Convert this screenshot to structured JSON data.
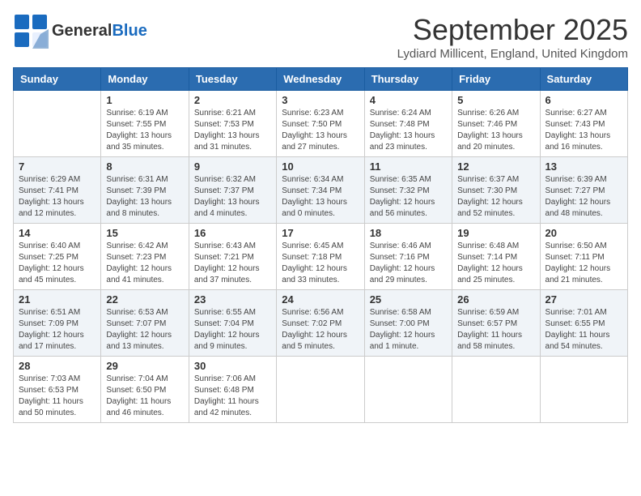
{
  "logo": {
    "line1": "General",
    "line2": "Blue"
  },
  "title": "September 2025",
  "location": "Lydiard Millicent, England, United Kingdom",
  "headers": [
    "Sunday",
    "Monday",
    "Tuesday",
    "Wednesday",
    "Thursday",
    "Friday",
    "Saturday"
  ],
  "weeks": [
    [
      {
        "day": "",
        "info": ""
      },
      {
        "day": "1",
        "info": "Sunrise: 6:19 AM\nSunset: 7:55 PM\nDaylight: 13 hours\nand 35 minutes."
      },
      {
        "day": "2",
        "info": "Sunrise: 6:21 AM\nSunset: 7:53 PM\nDaylight: 13 hours\nand 31 minutes."
      },
      {
        "day": "3",
        "info": "Sunrise: 6:23 AM\nSunset: 7:50 PM\nDaylight: 13 hours\nand 27 minutes."
      },
      {
        "day": "4",
        "info": "Sunrise: 6:24 AM\nSunset: 7:48 PM\nDaylight: 13 hours\nand 23 minutes."
      },
      {
        "day": "5",
        "info": "Sunrise: 6:26 AM\nSunset: 7:46 PM\nDaylight: 13 hours\nand 20 minutes."
      },
      {
        "day": "6",
        "info": "Sunrise: 6:27 AM\nSunset: 7:43 PM\nDaylight: 13 hours\nand 16 minutes."
      }
    ],
    [
      {
        "day": "7",
        "info": "Sunrise: 6:29 AM\nSunset: 7:41 PM\nDaylight: 13 hours\nand 12 minutes."
      },
      {
        "day": "8",
        "info": "Sunrise: 6:31 AM\nSunset: 7:39 PM\nDaylight: 13 hours\nand 8 minutes."
      },
      {
        "day": "9",
        "info": "Sunrise: 6:32 AM\nSunset: 7:37 PM\nDaylight: 13 hours\nand 4 minutes."
      },
      {
        "day": "10",
        "info": "Sunrise: 6:34 AM\nSunset: 7:34 PM\nDaylight: 13 hours\nand 0 minutes."
      },
      {
        "day": "11",
        "info": "Sunrise: 6:35 AM\nSunset: 7:32 PM\nDaylight: 12 hours\nand 56 minutes."
      },
      {
        "day": "12",
        "info": "Sunrise: 6:37 AM\nSunset: 7:30 PM\nDaylight: 12 hours\nand 52 minutes."
      },
      {
        "day": "13",
        "info": "Sunrise: 6:39 AM\nSunset: 7:27 PM\nDaylight: 12 hours\nand 48 minutes."
      }
    ],
    [
      {
        "day": "14",
        "info": "Sunrise: 6:40 AM\nSunset: 7:25 PM\nDaylight: 12 hours\nand 45 minutes."
      },
      {
        "day": "15",
        "info": "Sunrise: 6:42 AM\nSunset: 7:23 PM\nDaylight: 12 hours\nand 41 minutes."
      },
      {
        "day": "16",
        "info": "Sunrise: 6:43 AM\nSunset: 7:21 PM\nDaylight: 12 hours\nand 37 minutes."
      },
      {
        "day": "17",
        "info": "Sunrise: 6:45 AM\nSunset: 7:18 PM\nDaylight: 12 hours\nand 33 minutes."
      },
      {
        "day": "18",
        "info": "Sunrise: 6:46 AM\nSunset: 7:16 PM\nDaylight: 12 hours\nand 29 minutes."
      },
      {
        "day": "19",
        "info": "Sunrise: 6:48 AM\nSunset: 7:14 PM\nDaylight: 12 hours\nand 25 minutes."
      },
      {
        "day": "20",
        "info": "Sunrise: 6:50 AM\nSunset: 7:11 PM\nDaylight: 12 hours\nand 21 minutes."
      }
    ],
    [
      {
        "day": "21",
        "info": "Sunrise: 6:51 AM\nSunset: 7:09 PM\nDaylight: 12 hours\nand 17 minutes."
      },
      {
        "day": "22",
        "info": "Sunrise: 6:53 AM\nSunset: 7:07 PM\nDaylight: 12 hours\nand 13 minutes."
      },
      {
        "day": "23",
        "info": "Sunrise: 6:55 AM\nSunset: 7:04 PM\nDaylight: 12 hours\nand 9 minutes."
      },
      {
        "day": "24",
        "info": "Sunrise: 6:56 AM\nSunset: 7:02 PM\nDaylight: 12 hours\nand 5 minutes."
      },
      {
        "day": "25",
        "info": "Sunrise: 6:58 AM\nSunset: 7:00 PM\nDaylight: 12 hours\nand 1 minute."
      },
      {
        "day": "26",
        "info": "Sunrise: 6:59 AM\nSunset: 6:57 PM\nDaylight: 11 hours\nand 58 minutes."
      },
      {
        "day": "27",
        "info": "Sunrise: 7:01 AM\nSunset: 6:55 PM\nDaylight: 11 hours\nand 54 minutes."
      }
    ],
    [
      {
        "day": "28",
        "info": "Sunrise: 7:03 AM\nSunset: 6:53 PM\nDaylight: 11 hours\nand 50 minutes."
      },
      {
        "day": "29",
        "info": "Sunrise: 7:04 AM\nSunset: 6:50 PM\nDaylight: 11 hours\nand 46 minutes."
      },
      {
        "day": "30",
        "info": "Sunrise: 7:06 AM\nSunset: 6:48 PM\nDaylight: 11 hours\nand 42 minutes."
      },
      {
        "day": "",
        "info": ""
      },
      {
        "day": "",
        "info": ""
      },
      {
        "day": "",
        "info": ""
      },
      {
        "day": "",
        "info": ""
      }
    ]
  ]
}
